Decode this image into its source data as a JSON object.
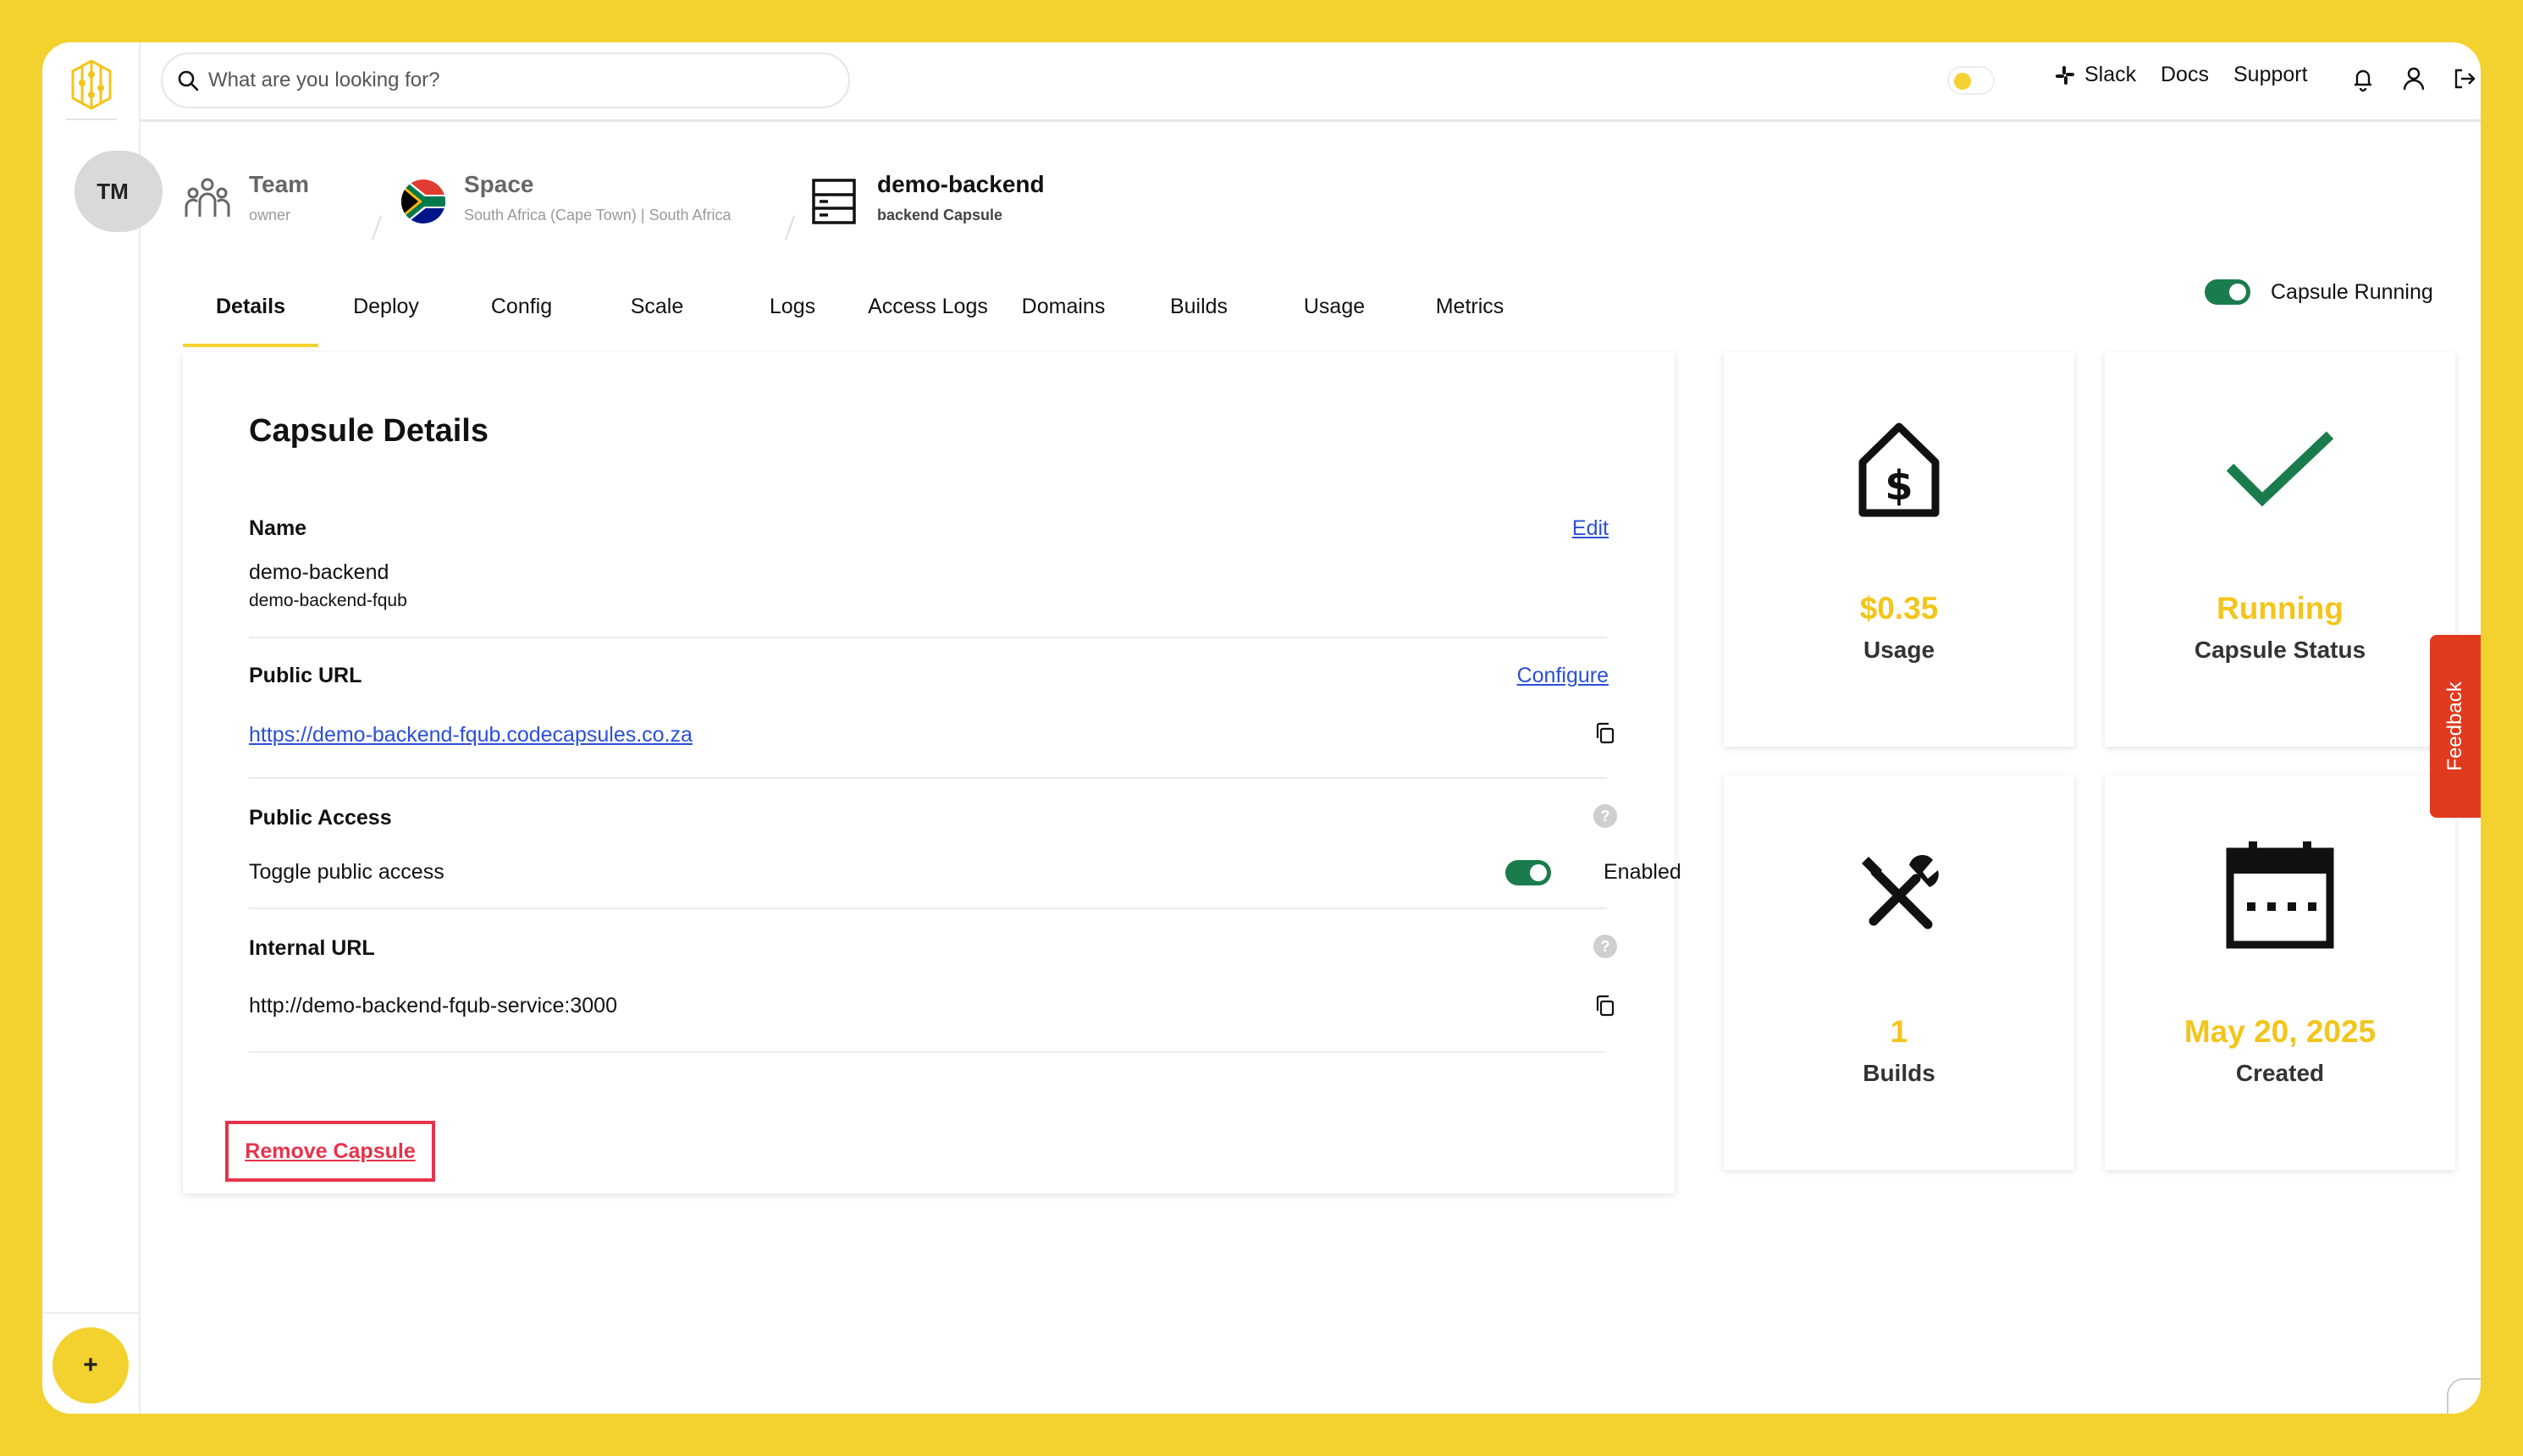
{
  "search": {
    "placeholder": "What are you looking for?"
  },
  "sidebar": {
    "avatar_initials": "TM",
    "add_label": "+"
  },
  "topnav": {
    "slack": "Slack",
    "docs": "Docs",
    "support": "Support"
  },
  "breadcrumb": {
    "team": {
      "title": "Team",
      "subtitle": "owner"
    },
    "space": {
      "title": "Space",
      "subtitle": "South Africa (Cape Town) | South Africa"
    },
    "capsule": {
      "title": "demo-backend",
      "subtitle": "backend Capsule"
    }
  },
  "tabs": [
    "Details",
    "Deploy",
    "Config",
    "Scale",
    "Logs",
    "Access Logs",
    "Domains",
    "Builds",
    "Usage",
    "Metrics"
  ],
  "active_tab": "Details",
  "capsule_running": {
    "label": "Capsule Running",
    "on": true
  },
  "details": {
    "title": "Capsule Details",
    "name_label": "Name",
    "edit": "Edit",
    "name_value": "demo-backend",
    "name_sub": "demo-backend-fqub",
    "public_url_label": "Public URL",
    "configure": "Configure",
    "public_url": "https://demo-backend-fqub.codecapsules.co.za",
    "public_access_label": "Public Access",
    "toggle_text": "Toggle public access",
    "enabled_text": "Enabled",
    "internal_url_label": "Internal URL",
    "internal_url": "http://demo-backend-fqub-service:3000",
    "remove": "Remove Capsule",
    "help_glyph": "?"
  },
  "stats": {
    "usage": {
      "value": "$0.35",
      "label": "Usage"
    },
    "status": {
      "value": "Running",
      "label": "Capsule Status"
    },
    "builds": {
      "value": "1",
      "label": "Builds"
    },
    "created": {
      "value": "May 20, 2025",
      "label": "Created"
    }
  },
  "feedback": "Feedback",
  "colors": {
    "accent": "#f3d22f",
    "value": "#f3c51c",
    "success": "#1a7c4c",
    "danger": "#e5334b",
    "link": "#2b4fd6",
    "feedback": "#e03a1f"
  }
}
